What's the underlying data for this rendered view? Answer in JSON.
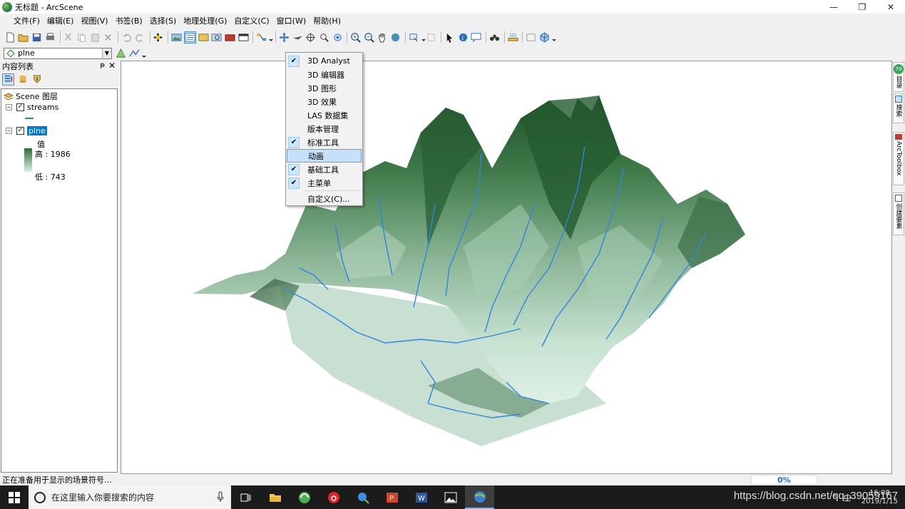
{
  "window": {
    "title": "无标题 - ArcScene",
    "controls": [
      "—",
      "❐",
      "✕"
    ]
  },
  "menubar": {
    "items": [
      "文件(F)",
      "编辑(E)",
      "视图(V)",
      "书签(B)",
      "选择(S)",
      "地理处理(G)",
      "自定义(C)",
      "窗口(W)",
      "帮助(H)"
    ]
  },
  "layerbar": {
    "selected_layer": "plne"
  },
  "toc": {
    "title": "内容列表",
    "pin_glyph": "ᵽ",
    "close_glyph": "✕",
    "root_label": "Scene 图层",
    "layers": [
      {
        "name": "streams",
        "checked": true,
        "expanded": true
      },
      {
        "name": "plne",
        "checked": true,
        "expanded": true,
        "selected": true
      }
    ],
    "legend": {
      "value_label": "值",
      "high_label": "高 : 1986",
      "low_label": "低 : 743"
    },
    "colors": {
      "stream_line": "#2a7fd4",
      "ramp_high": "#2f6b3c",
      "ramp_low": "#d9efe3"
    }
  },
  "popup_menu": {
    "items": [
      {
        "label": "3D Analyst",
        "checked": true
      },
      {
        "label": "3D 编辑器",
        "checked": false
      },
      {
        "label": "3D 图形",
        "checked": false
      },
      {
        "label": "3D 效果",
        "checked": false
      },
      {
        "label": "LAS 数据集",
        "checked": false
      },
      {
        "label": "版本管理",
        "checked": false
      },
      {
        "label": "标准工具",
        "checked": true
      },
      {
        "label": "动画",
        "checked": false,
        "highlighted": true
      },
      {
        "label": "基础工具",
        "checked": true
      },
      {
        "label": "主菜单",
        "checked": true
      },
      {
        "label": "自定义(C)...",
        "checked": false
      }
    ],
    "check_glyph": "✔"
  },
  "right_dock": {
    "tabs": [
      "目录",
      "搜索",
      "ArcToolbox",
      "创建要素"
    ],
    "badge": "70"
  },
  "status": {
    "text": "正在准备用于显示的场景符号...",
    "progress": "0%"
  },
  "taskbar": {
    "search_placeholder": "在这里输入你要搜索的内容",
    "clock_time": "16:08",
    "clock_date": "2019/1/15",
    "input_method": "中",
    "watermark": "https://blog.csdn.net/qq_39059167"
  },
  "scene": {
    "colors": {
      "peak": "#245a30",
      "mid": "#7ea58a",
      "low": "#cde5d6",
      "stream": "#2f86e0"
    }
  }
}
